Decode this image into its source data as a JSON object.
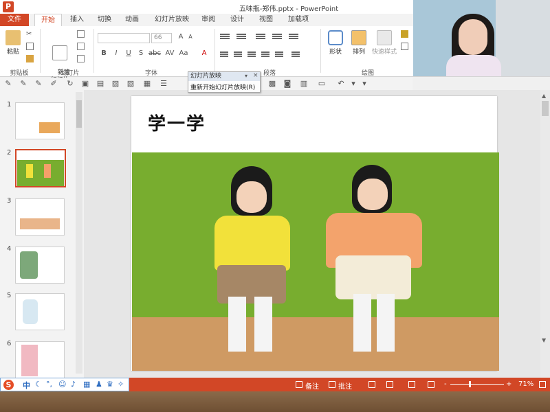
{
  "window": {
    "title": "五味瓶-郑伟.pptx - PowerPoint",
    "app_icon": "P"
  },
  "tabs": [
    "文件",
    "开始",
    "插入",
    "切换",
    "动画",
    "幻灯片放映",
    "审阅",
    "设计",
    "视图",
    "加载项"
  ],
  "ribbon": {
    "clipboard": {
      "label": "剪贴板",
      "paste": "粘贴"
    },
    "slides": {
      "label": "幻灯片",
      "new_slide": "新建\n幻灯片"
    },
    "font": {
      "label": "字体",
      "size": "66"
    },
    "paragraph": {
      "label": "段落"
    },
    "drawing": {
      "label": "绘图",
      "shape": "形状",
      "arrange": "排列",
      "quick_styles": "快速样式"
    }
  },
  "slideshow_menu": {
    "title": "幻灯片放映",
    "item": "重新开始幻灯片放映(R)"
  },
  "thumbnails": [
    {
      "num": "1"
    },
    {
      "num": "2",
      "selected": true
    },
    {
      "num": "3"
    },
    {
      "num": "4"
    },
    {
      "num": "5"
    },
    {
      "num": "6"
    }
  ],
  "slide": {
    "title": "学一学"
  },
  "statusbar": {
    "notes": "备注",
    "comments": "批注",
    "zoom": "71%"
  },
  "ime": {
    "logo": "S",
    "mode": "中"
  },
  "colors": {
    "accent": "#d24726",
    "photo_bg": "#78ad2f"
  }
}
